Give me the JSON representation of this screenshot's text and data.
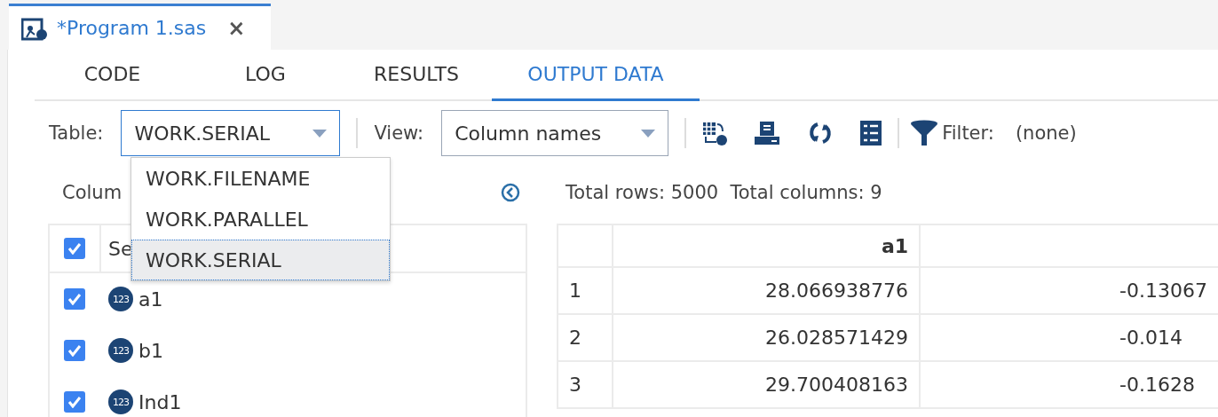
{
  "file_tab": {
    "title": "*Program 1.sas",
    "close": "×"
  },
  "tabs": [
    {
      "label": "CODE",
      "selected": false
    },
    {
      "label": "LOG",
      "selected": false
    },
    {
      "label": "RESULTS",
      "selected": false
    },
    {
      "label": "OUTPUT DATA",
      "selected": true
    }
  ],
  "toolbar": {
    "table_label": "Table:",
    "table_value": "WORK.SERIAL",
    "view_label": "View:",
    "view_value": "Column names",
    "filter_label": "Filter:",
    "filter_value": "(none)"
  },
  "table_menu": {
    "expanded": true,
    "options": [
      {
        "label": "WORK.FILENAME",
        "selected": false
      },
      {
        "label": "WORK.PARALLEL",
        "selected": false
      },
      {
        "label": "WORK.SERIAL",
        "selected": true
      }
    ]
  },
  "columns_panel": {
    "title": "Colum",
    "header": {
      "label": "Se",
      "checked": true
    },
    "items": [
      {
        "name": "a1",
        "type": "123",
        "checked": true
      },
      {
        "name": "b1",
        "type": "123",
        "checked": true
      },
      {
        "name": "Ind1",
        "type": "123",
        "checked": true
      }
    ]
  },
  "grid": {
    "summary": "Total rows: 5000  Total columns: 9",
    "columns": [
      "a1"
    ],
    "rows": [
      {
        "index": "1",
        "a1": "28.066938776",
        "column_3": "-0.13067"
      },
      {
        "index": "2",
        "a1": "26.028571429",
        "column_3": "-0.014"
      },
      {
        "index": "3",
        "a1": "29.700408163",
        "column_3": "-0.1628"
      }
    ]
  }
}
